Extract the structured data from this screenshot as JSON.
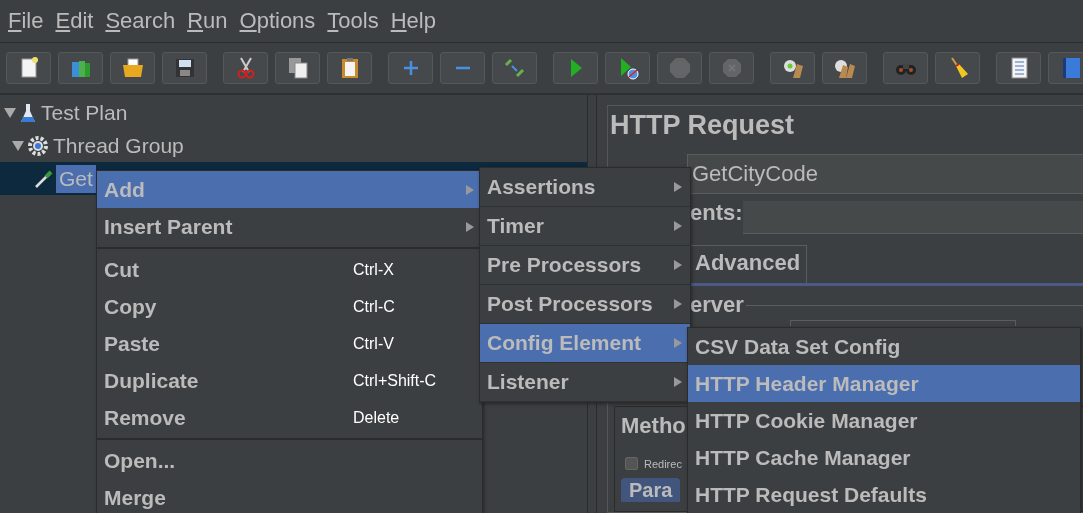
{
  "menubar": [
    {
      "label": "File"
    },
    {
      "label": "Edit"
    },
    {
      "label": "Search"
    },
    {
      "label": "Run"
    },
    {
      "label": "Options"
    },
    {
      "label": "Tools"
    },
    {
      "label": "Help"
    }
  ],
  "toolbar": [
    {
      "buttons": [
        {
          "kind": "new",
          "disabled": false
        },
        {
          "kind": "templates",
          "disabled": false
        },
        {
          "kind": "open",
          "disabled": false
        },
        {
          "kind": "save",
          "disabled": false
        }
      ]
    },
    {
      "buttons": [
        {
          "kind": "cut",
          "disabled": false
        },
        {
          "kind": "copy",
          "disabled": false
        },
        {
          "kind": "paste",
          "disabled": false
        }
      ]
    },
    {
      "buttons": [
        {
          "kind": "expand",
          "disabled": false
        },
        {
          "kind": "collapse",
          "disabled": false
        },
        {
          "kind": "toggle",
          "disabled": false
        }
      ]
    },
    {
      "buttons": [
        {
          "kind": "start",
          "disabled": false
        },
        {
          "kind": "start-no-pause",
          "disabled": false
        },
        {
          "kind": "stop",
          "disabled": true
        },
        {
          "kind": "shutdown",
          "disabled": true
        }
      ]
    },
    {
      "buttons": [
        {
          "kind": "clear",
          "disabled": false
        },
        {
          "kind": "clear-all",
          "disabled": false
        }
      ]
    },
    {
      "buttons": [
        {
          "kind": "search",
          "disabled": false
        },
        {
          "kind": "reset-search",
          "disabled": false
        }
      ]
    },
    {
      "buttons": [
        {
          "kind": "function-helper",
          "disabled": false
        },
        {
          "kind": "help",
          "disabled": false
        }
      ]
    }
  ],
  "tree": [
    {
      "label": "Test Plan",
      "kind": "flask",
      "expanded": true,
      "selected": false,
      "children": [
        {
          "label": "Thread Group",
          "kind": "gear",
          "expanded": true,
          "selected": false,
          "children": [
            {
              "label": "Get",
              "kind": "pipette",
              "selected": true
            }
          ]
        }
      ]
    }
  ],
  "editor": {
    "title": "HTTP Request",
    "name_value": "GetCityCode",
    "comments_label": "ents:",
    "tab": "Advanced",
    "server_label": "erver",
    "method_label": "Metho",
    "redirect": {
      "label": "Redirec",
      "checked": false
    },
    "params_tab": "Para"
  },
  "context_menu": {
    "sections": [
      [
        {
          "label": "Add",
          "kind": "submenu",
          "selected": true
        },
        {
          "label": "Insert Parent",
          "kind": "submenu",
          "selected": false
        }
      ],
      [
        {
          "label": "Cut",
          "kind": "command",
          "shortcut": "Ctrl-X",
          "selected": false
        },
        {
          "label": "Copy",
          "kind": "command",
          "shortcut": "Ctrl-C",
          "selected": false
        },
        {
          "label": "Paste",
          "kind": "command",
          "shortcut": "Ctrl-V",
          "selected": false
        },
        {
          "label": "Duplicate",
          "kind": "command",
          "shortcut": "Ctrl+Shift-C",
          "selected": false
        },
        {
          "label": "Remove",
          "kind": "command",
          "shortcut": "Delete",
          "selected": false
        }
      ],
      [
        {
          "label": "Open...",
          "kind": "command",
          "selected": false
        },
        {
          "label": "Merge",
          "kind": "command",
          "selected": false
        }
      ]
    ]
  },
  "add_submenu": [
    {
      "label": "Assertions",
      "kind": "submenu",
      "selected": false
    },
    {
      "label": "Timer",
      "kind": "submenu",
      "selected": false
    },
    {
      "label": "Pre Processors",
      "kind": "submenu",
      "selected": false
    },
    {
      "label": "Post Processors",
      "kind": "submenu",
      "selected": false
    },
    {
      "label": "Config Element",
      "kind": "submenu",
      "selected": true
    },
    {
      "label": "Listener",
      "kind": "submenu",
      "selected": false
    }
  ],
  "config_submenu": [
    {
      "label": "CSV Data Set Config",
      "selected": false
    },
    {
      "label": "HTTP Header Manager",
      "selected": true
    },
    {
      "label": "HTTP Cookie Manager",
      "selected": false
    },
    {
      "label": "HTTP Cache Manager",
      "selected": false
    },
    {
      "label": "HTTP Request Defaults",
      "selected": false
    }
  ]
}
